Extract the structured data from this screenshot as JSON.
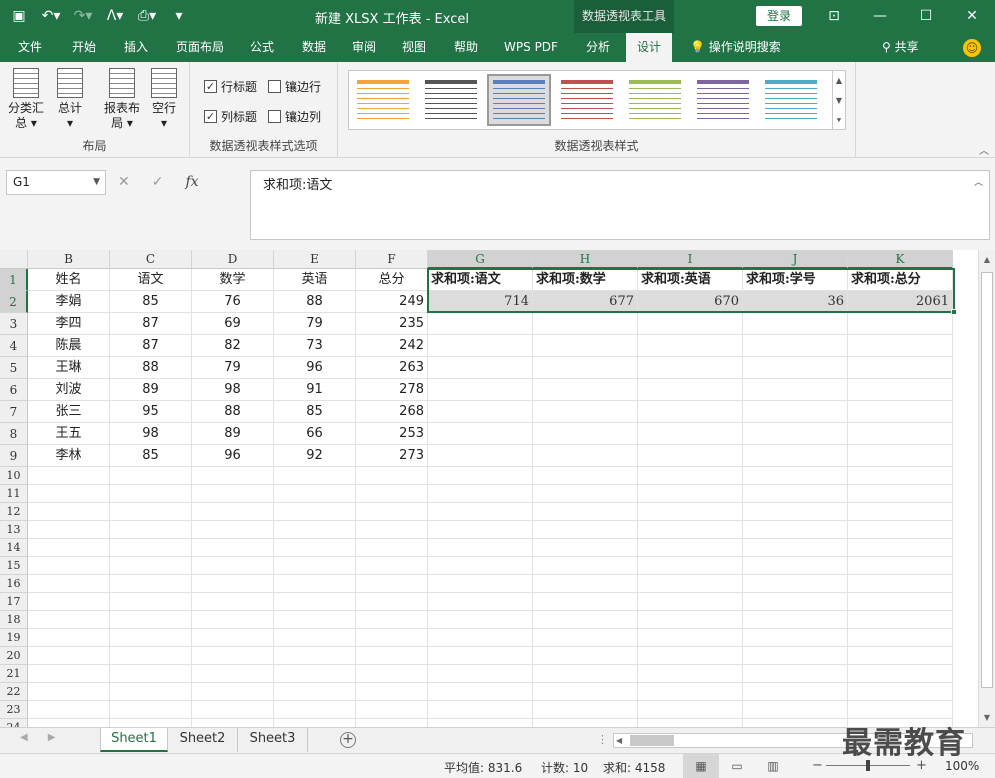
{
  "window": {
    "title": "新建 XLSX 工作表  -  Excel",
    "context_tool": "数据透视表工具",
    "login": "登录"
  },
  "tabs": [
    "文件",
    "开始",
    "插入",
    "页面布局",
    "公式",
    "数据",
    "审阅",
    "视图",
    "帮助",
    "WPS PDF",
    "分析",
    "设计"
  ],
  "active_tab": "设计",
  "tell_me": "操作说明搜索",
  "share": "共享",
  "ribbon": {
    "layout_group": {
      "label": "布局",
      "buttons": [
        "分类汇总",
        "总计",
        "报表布局",
        "空行"
      ]
    },
    "options_group": {
      "label": "数据透视表样式选项",
      "row_headers": "行标题",
      "col_headers": "列标题",
      "banded_rows": "镶边行",
      "banded_cols": "镶边列",
      "row_headers_checked": true,
      "col_headers_checked": true,
      "banded_rows_checked": false,
      "banded_cols_checked": false
    },
    "styles_group": {
      "label": "数据透视表样式",
      "swatch_colors": [
        "#f2a33a",
        "#555555",
        "#5b7fb8",
        "#c0504d",
        "#9bbb59",
        "#8064a2",
        "#4bacc6"
      ]
    }
  },
  "formula_bar": {
    "name_box": "G1",
    "formula": "求和项:语文"
  },
  "grid": {
    "columns": [
      "B",
      "C",
      "D",
      "E",
      "F",
      "G",
      "H",
      "I",
      "J",
      "K"
    ],
    "rows": [
      "1",
      "2",
      "3",
      "4",
      "5",
      "6",
      "7",
      "8",
      "9",
      "10",
      "11",
      "12",
      "13",
      "14",
      "15",
      "16",
      "17",
      "18",
      "19",
      "20",
      "21",
      "22",
      "23",
      "24"
    ],
    "table_header": [
      "姓名",
      "语文",
      "数学",
      "英语",
      "总分"
    ],
    "table_rows": [
      [
        "李娟",
        "85",
        "76",
        "88",
        "249"
      ],
      [
        "李四",
        "87",
        "69",
        "79",
        "235"
      ],
      [
        "陈晨",
        "87",
        "82",
        "73",
        "242"
      ],
      [
        "王琳",
        "88",
        "79",
        "96",
        "263"
      ],
      [
        "刘波",
        "89",
        "98",
        "91",
        "278"
      ],
      [
        "张三",
        "95",
        "88",
        "85",
        "268"
      ],
      [
        "王五",
        "98",
        "89",
        "66",
        "253"
      ],
      [
        "李林",
        "85",
        "96",
        "92",
        "273"
      ]
    ],
    "pivot_header": [
      "求和项:语文",
      "求和项:数学",
      "求和项:英语",
      "求和项:学号",
      "求和项:总分"
    ],
    "pivot_values": [
      "714",
      "677",
      "670",
      "36",
      "2061"
    ]
  },
  "sheets": [
    "Sheet1",
    "Sheet2",
    "Sheet3"
  ],
  "active_sheet": "Sheet1",
  "status": {
    "average": "平均值: 831.6",
    "count": "计数: 10",
    "sum": "求和: 4158",
    "zoom": "100%"
  },
  "watermark": "最需教育"
}
